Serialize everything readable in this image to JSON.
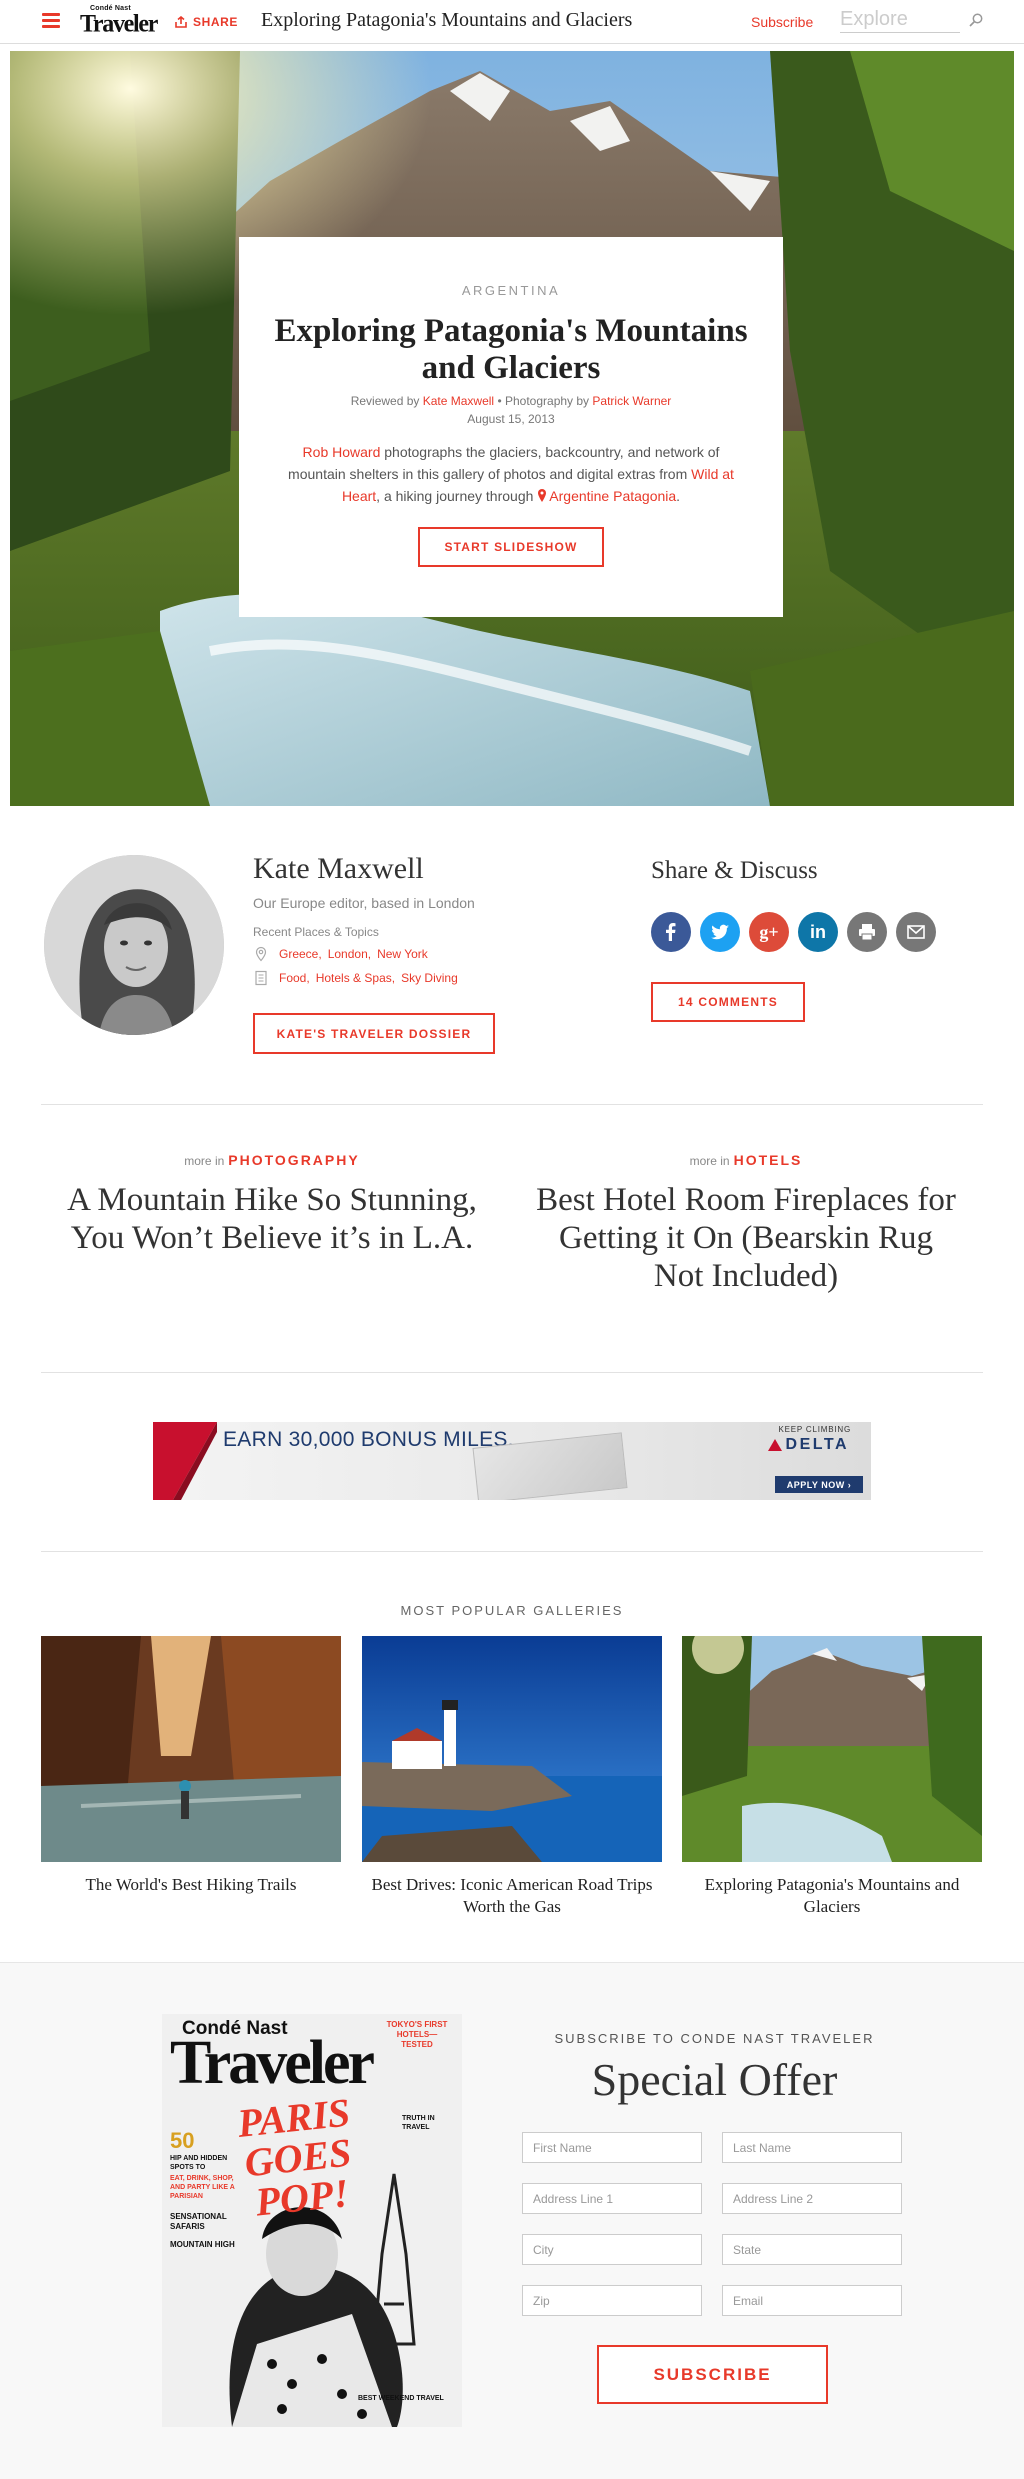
{
  "nav": {
    "share_label": "SHARE",
    "title": "Exploring Patagonia's Mountains and Glaciers",
    "subscribe_label": "Subscribe",
    "explore_placeholder": "Explore",
    "logo_top": "Condé Nast",
    "logo_main": "Traveler"
  },
  "hero": {
    "kicker": "ARGENTINA",
    "title": "Exploring Patagonia's Mountains and Glaciers",
    "reviewed_by_prefix": "Reviewed by",
    "reviewer": "Kate Maxwell",
    "photography_prefix": "• Photography by",
    "photographer": "Patrick Warner",
    "date": "August 15, 2013",
    "dek": {
      "link1": "Rob Howard",
      "text1": " photographs the glaciers, backcountry, and network of mountain shelters in this gallery of photos and digital extras from ",
      "link2": "Wild at Heart",
      "text2": ", a hiking journey through ",
      "link3": "Argentine Patagonia",
      "text3": "."
    },
    "slideshow_label": "START SLIDESHOW"
  },
  "author": {
    "name": "Kate Maxwell",
    "role": "Our Europe editor, based in London",
    "recent_label": "Recent Places & Topics",
    "places": [
      "Greece",
      "London",
      "New York"
    ],
    "topics": [
      "Food",
      "Hotels & Spas",
      "Sky Diving"
    ],
    "dossier_label": "KATE'S TRAVELER DOSSIER"
  },
  "share_discuss": {
    "title": "Share & Discuss",
    "comments_label": "14 COMMENTS",
    "icons": [
      "facebook-icon",
      "twitter-icon",
      "google-plus-icon",
      "linkedin-icon",
      "print-icon",
      "email-icon"
    ]
  },
  "more_in": [
    {
      "prefix": "more in",
      "section": "PHOTOGRAPHY",
      "title": "A Mountain Hike So Stunning, You Won’t Believe it’s in L.A."
    },
    {
      "prefix": "more in",
      "section": "HOTELS",
      "title": "Best Hotel Room Fireplaces for Getting it On (Bearskin Rug Not Included)"
    }
  ],
  "ad": {
    "headline": "EARN 30,000 BONUS MILES.",
    "tagline": "KEEP CLIMBING",
    "brand": "DELTA",
    "cta": "APPLY NOW ›"
  },
  "popular": {
    "title": "MOST POPULAR GALLERIES",
    "items": [
      {
        "caption": "The World's Best Hiking Trails"
      },
      {
        "caption": "Best Drives: Iconic American Road Trips Worth the Gas"
      },
      {
        "caption": "Exploring Patagonia's Mountains and Glaciers"
      }
    ]
  },
  "subscribe": {
    "kicker": "SUBSCRIBE TO CONDE NAST TRAVELER",
    "title": "Special Offer",
    "fields": {
      "first_name": "First Name",
      "last_name": "Last Name",
      "address1": "Address Line 1",
      "address2": "Address Line 2",
      "city": "City",
      "state": "State",
      "zip": "Zip",
      "email": "Email"
    },
    "button_label": "SUBSCRIBE",
    "magazine": {
      "brand_top": "Condé Nast",
      "brand_main": "Traveler",
      "cover_line_red": "PARIS GOES POP!",
      "corner_line": "TOKYO'S FIRST HOTELS— TESTED",
      "side_number": "50",
      "side_line1": "HIP AND HIDDEN SPOTS TO",
      "side_line2": "EAT, DRINK, SHOP, AND PARTY LIKE A PARISIAN",
      "side_line3": "SENSATIONAL SAFARIS",
      "side_line4": "MOUNTAIN HIGH",
      "right_line": "TRUTH IN TRAVEL",
      "bottom_line": "BEST WEEKEND TRAVEL"
    }
  },
  "colors": {
    "accent": "#e8392a",
    "facebook": "#3b5998",
    "twitter": "#1da1f2",
    "google_plus": "#dd4b39",
    "linkedin": "#0e76a8",
    "print": "#777777",
    "email": "#777777",
    "delta_navy": "#1f3b6e"
  }
}
